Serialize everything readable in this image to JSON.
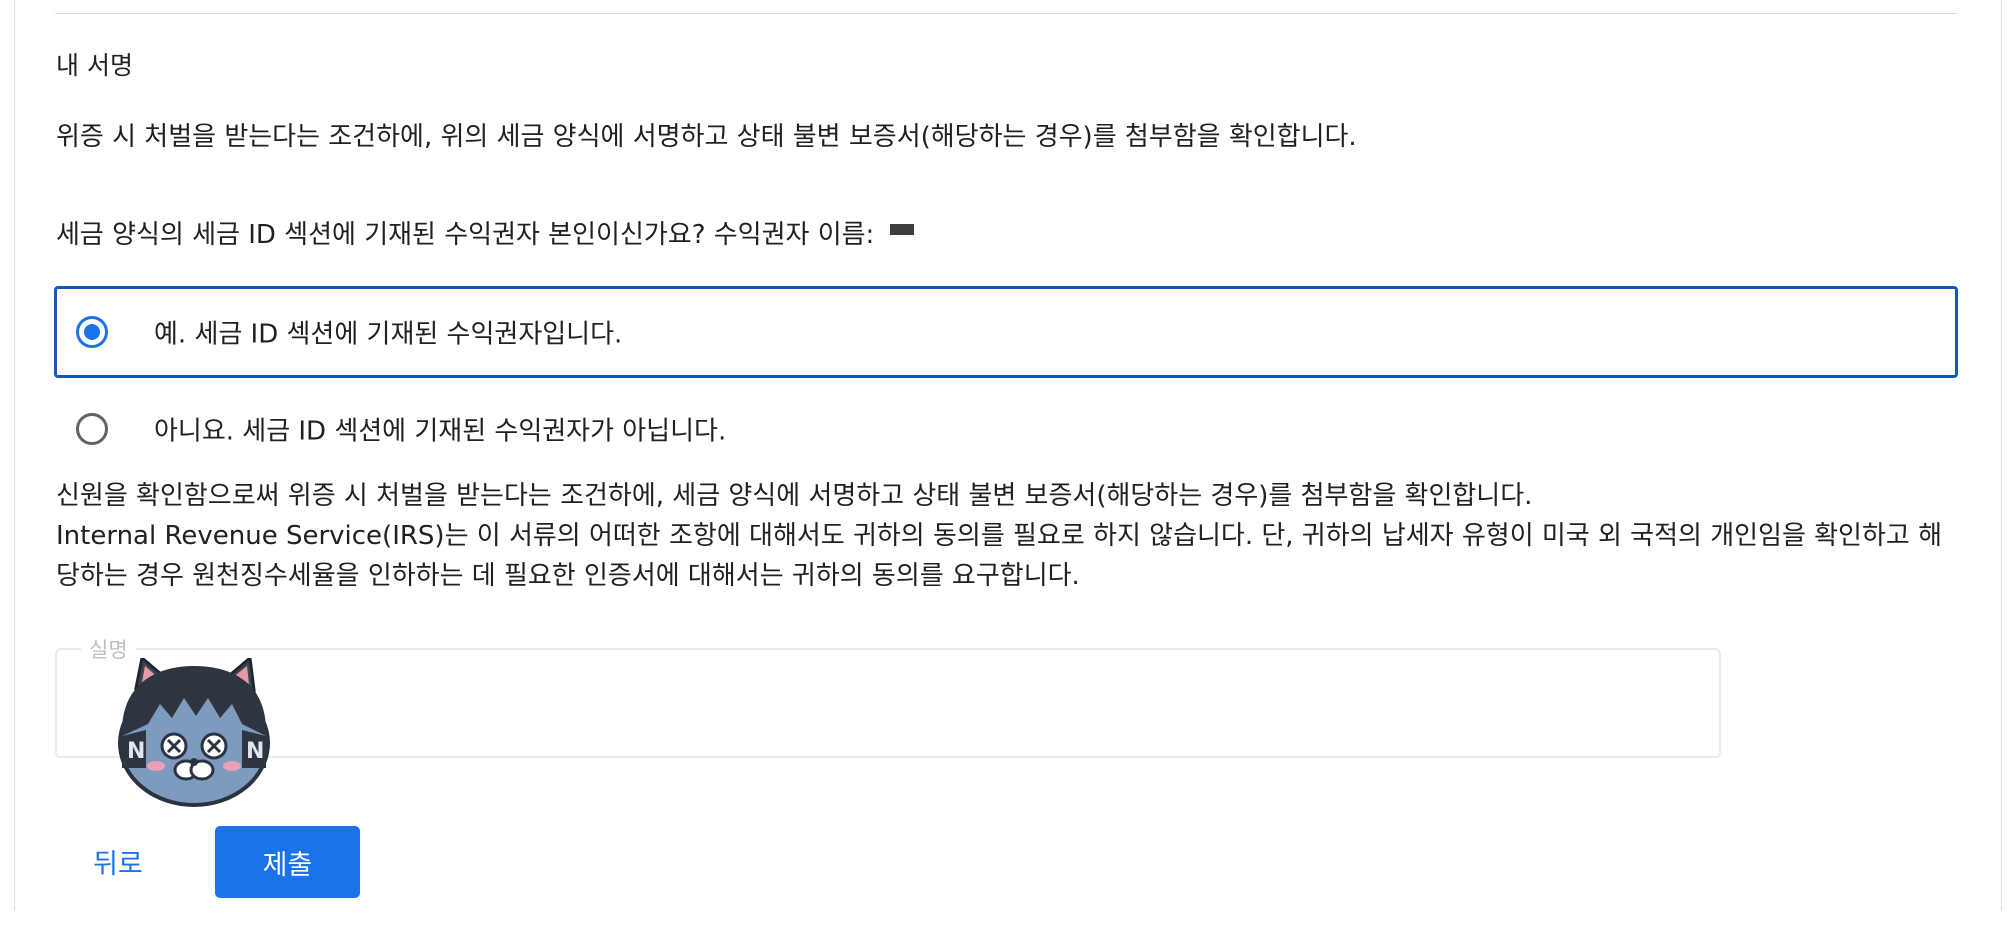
{
  "signature_section": {
    "title": "내 서명",
    "declaration": "위증 시 처벌을 받는다는 조건하에, 위의 세금 양식에 서명하고 상태 불변 보증서(해당하는 경우)를 첨부함을 확인합니다.",
    "payee_question": "세금 양식의 세금 ID 섹션에 기재된 수익권자 본인이신가요? 수익권자 이름:"
  },
  "options": [
    {
      "label": "예. 세금 ID 섹션에 기재된 수익권자입니다.",
      "selected": true
    },
    {
      "label": "아니요. 세금 ID 섹션에 기재된 수익권자가 아닙니다.",
      "selected": false
    }
  ],
  "consent": {
    "line1": "신원을 확인함으로써 위증 시 처벌을 받는다는 조건하에, 세금 양식에 서명하고 상태 불변 보증서(해당하는 경우)를 첨부함을 확인합니다.",
    "line2": "Internal Revenue Service(IRS)는 이 서류의 어떠한 조항에 대해서도 귀하의 동의를 필요로 하지 않습니다. 단, 귀하의 납세자 유형이 미국 외 국적의 개인임을 확인하고 해당하는 경우 원천징수세율을 인하하는 데 필요한 인증서에 대해서는 귀하의 동의를 요구합니다."
  },
  "name_field": {
    "label": "실명",
    "value": ""
  },
  "buttons": {
    "back": "뒤로",
    "submit": "제출"
  },
  "colors": {
    "accent": "#1a73e8",
    "selected_border": "#1557c0",
    "divider": "#dadce0"
  },
  "icons": {
    "sticker": "cat-sticker-icon",
    "radio_selected": "radio-checked-icon",
    "radio_unselected": "radio-unchecked-icon"
  }
}
